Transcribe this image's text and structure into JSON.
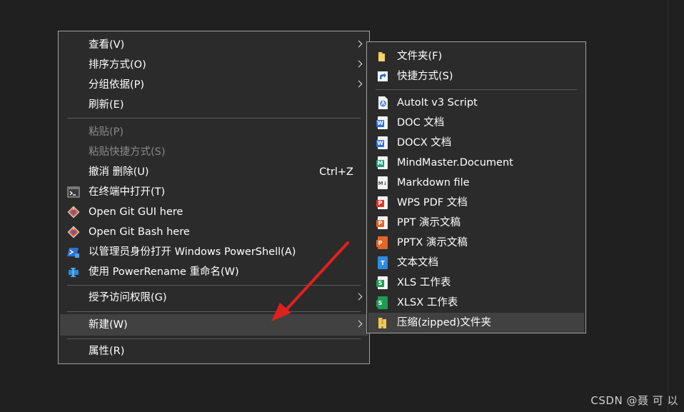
{
  "main_menu": {
    "items": [
      {
        "label": "查看(V)",
        "submenu": true
      },
      {
        "label": "排序方式(O)",
        "submenu": true
      },
      {
        "label": "分组依据(P)",
        "submenu": true
      },
      {
        "label": "刷新(E)"
      },
      {
        "label": "粘贴(P)",
        "disabled": true
      },
      {
        "label": "粘贴快捷方式(S)",
        "disabled": true
      },
      {
        "label": "撤消 删除(U)",
        "shortcut": "Ctrl+Z"
      },
      {
        "label": "在终端中打开(T)",
        "icon": "terminal-icon"
      },
      {
        "label": "Open Git GUI here",
        "icon": "git-icon"
      },
      {
        "label": "Open Git Bash here",
        "icon": "git-icon"
      },
      {
        "label": "以管理员身份打开 Windows PowerShell(A)",
        "icon": "powershell-icon"
      },
      {
        "label": "使用 PowerRename 重命名(W)",
        "icon": "power-rename-icon"
      },
      {
        "label": "授予访问权限(G)",
        "submenu": true
      },
      {
        "label": "新建(W)",
        "submenu": true,
        "hovered": true
      },
      {
        "label": "属性(R)"
      }
    ]
  },
  "new_submenu": {
    "items": [
      {
        "label": "文件夹(F)",
        "icon": "folder-icon"
      },
      {
        "label": "快捷方式(S)",
        "icon": "shortcut-icon"
      },
      {
        "label": "AutoIt v3 Script",
        "icon": "autoit-icon"
      },
      {
        "label": "DOC 文档",
        "icon": "word-doc-icon",
        "badge": "W"
      },
      {
        "label": "DOCX 文档",
        "icon": "word-docx-icon",
        "badge": "W"
      },
      {
        "label": "MindMaster.Document",
        "icon": "mindmaster-icon",
        "badge": "M"
      },
      {
        "label": "Markdown file",
        "icon": "markdown-icon",
        "badge": "M↓"
      },
      {
        "label": "WPS PDF 文档",
        "icon": "pdf-icon",
        "badge": "P"
      },
      {
        "label": "PPT 演示文稿",
        "icon": "ppt-icon",
        "badge": "P"
      },
      {
        "label": "PPTX 演示文稿",
        "icon": "pptx-icon",
        "badge": "P"
      },
      {
        "label": "文本文档",
        "icon": "text-doc-icon",
        "badge": "T"
      },
      {
        "label": "XLS 工作表",
        "icon": "xls-icon",
        "badge": "S"
      },
      {
        "label": "XLSX 工作表",
        "icon": "xlsx-icon",
        "badge": "S"
      },
      {
        "label": "压缩(zipped)文件夹",
        "icon": "zip-folder-icon",
        "hovered": true
      }
    ]
  },
  "watermark": "CSDN @聂 可 以",
  "colors": {
    "menu_bg": "#2b2b2b",
    "hover_bg": "#414141",
    "arrow": "#e0201d",
    "word": "#2b6fd6",
    "excel": "#1f9b53",
    "ppt": "#e0662a",
    "pdf": "#e0332a",
    "text": "#2f8be0",
    "mindmaster": "#1aa37a",
    "folder": "#f2c94c"
  }
}
